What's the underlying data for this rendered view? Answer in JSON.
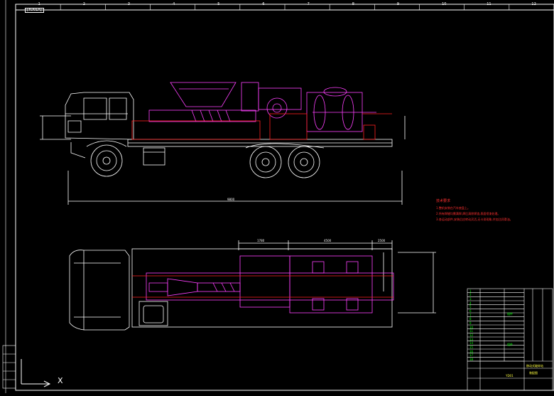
{
  "drawing": {
    "stamp": "[YD01A]",
    "ruler_numbers": [
      "1",
      "2",
      "3",
      "4",
      "5",
      "6",
      "7",
      "8",
      "9",
      "10",
      "11",
      "12"
    ],
    "dimensions": {
      "overall_length": "9800",
      "plan_1": "1780",
      "plan_2": "4500",
      "plan_3": "2500"
    },
    "notes": {
      "title": "技术要求",
      "lines": [
        "1.整机安装在汽车底盘上。",
        "2.所有焊缝均需满焊,焊后清除焊渣,表面喷漆处理。",
        "3.各运动部件,安装后应转动灵活,无卡滞现象,并加注润滑油。"
      ]
    },
    "axis_label": "X",
    "colors": {
      "background": "#000000",
      "primary_line": "#ffffff",
      "machine": "#ff40ff",
      "frame": "#ff2020",
      "notes": "#ff3030",
      "table_text": "#00ff00"
    }
  },
  "title_block": {
    "rows": [
      "1",
      "2",
      "3",
      "4",
      "5",
      "6",
      "7",
      "8",
      "9",
      "10",
      "11",
      "12",
      "13",
      "14",
      "15",
      "16",
      "17",
      "18"
    ],
    "mid_labels": [
      "组件",
      "组件"
    ],
    "drawing_name": "移动式破碎站",
    "drawing_no": "YD01",
    "unit": "装配图"
  }
}
